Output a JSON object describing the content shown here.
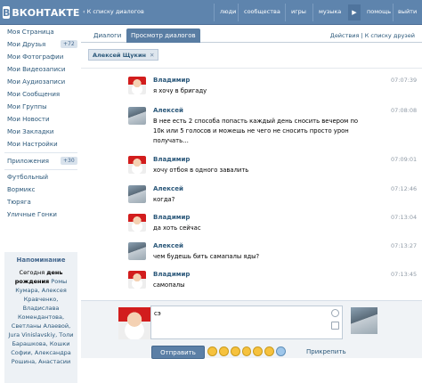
{
  "header": {
    "logo": "ВКОНТАКТЕ",
    "back": "К списку диалогов",
    "nav": [
      "люди",
      "сообщества",
      "игры",
      "музыка",
      "помощь",
      "выйти"
    ]
  },
  "sidebar": {
    "items": [
      {
        "label": "Моя Страница"
      },
      {
        "label": "Мои Друзья",
        "count": "+72"
      },
      {
        "label": "Мои Фотографии"
      },
      {
        "label": "Мои Видеозаписи"
      },
      {
        "label": "Мои Аудиозаписи"
      },
      {
        "label": "Мои Сообщения"
      },
      {
        "label": "Мои Группы"
      },
      {
        "label": "Мои Новости"
      },
      {
        "label": "Мои Закладки"
      },
      {
        "label": "Мои Настройки"
      }
    ],
    "apps": {
      "label": "Приложения",
      "count": "+30"
    },
    "groups": [
      "Футбольный",
      "Вормикс",
      "Тюряга",
      "Уличные Гонки"
    ],
    "reminder": {
      "title": "Напоминание",
      "today": "Сегодня",
      "birthday": "день рождения",
      "names": "Ромы Кумара, Алексея Кравченко, Владислава Комендантова, Светланы Алаевой, Jura Vinislavskiy, Толи Барашкова, Кошки Софии, Александра Рошина, Анастасии"
    }
  },
  "tabs": {
    "dialogs": "Диалоги",
    "view": "Просмотр диалогов",
    "actions": "Действия",
    "back": "К списку друзей"
  },
  "chip": {
    "name": "Алексей Щукин",
    "close": "✕"
  },
  "messages": [
    {
      "name": "Владимир",
      "text": "я хочу в бригаду",
      "time": "07:07:39"
    },
    {
      "name": "Алексей",
      "text": "В нее есть 2 способа попасть каждый день сносить вечером по 10к или 5 голосов и можешь не чего не сносить просто урон получать…",
      "time": "07:08:08"
    },
    {
      "name": "Владимир",
      "text": "хочу отбоя в одного завалить",
      "time": "07:09:01"
    },
    {
      "name": "Алексей",
      "text": "когда?",
      "time": "07:12:46"
    },
    {
      "name": "Владимир",
      "text": "да хоть сейчас",
      "time": "07:13:04"
    },
    {
      "name": "Алексей",
      "text": "чем будешь бить самапалы яды?",
      "time": "07:13:27"
    },
    {
      "name": "Владимир",
      "text": "самопалы",
      "time": "07:13:45"
    }
  ],
  "compose": {
    "value": "сэ",
    "send": "Отправить",
    "attach": "Прикрепить"
  }
}
